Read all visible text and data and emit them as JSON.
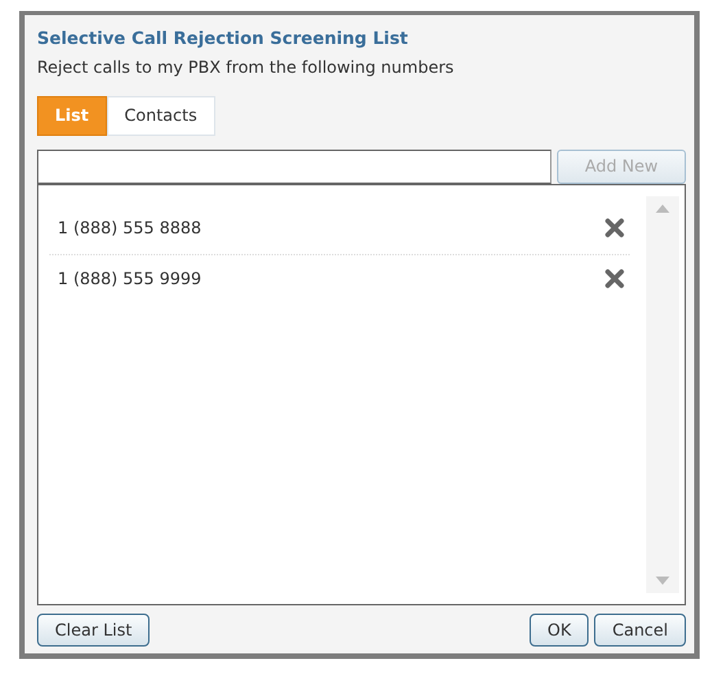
{
  "dialog": {
    "title": "Selective Call Rejection Screening List",
    "subtitle": "Reject calls to my PBX from the following numbers"
  },
  "tabs": [
    {
      "label": "List",
      "selected": true
    },
    {
      "label": "Contacts",
      "selected": false
    }
  ],
  "add_button": {
    "label": "Add New",
    "disabled": true
  },
  "numbers": [
    {
      "number": "1 (888) 555 8888"
    },
    {
      "number": "1 (888) 555 9999"
    }
  ],
  "footer": {
    "clear_button": "Clear List",
    "ok_button": "OK",
    "cancel_button": "Cancel"
  }
}
